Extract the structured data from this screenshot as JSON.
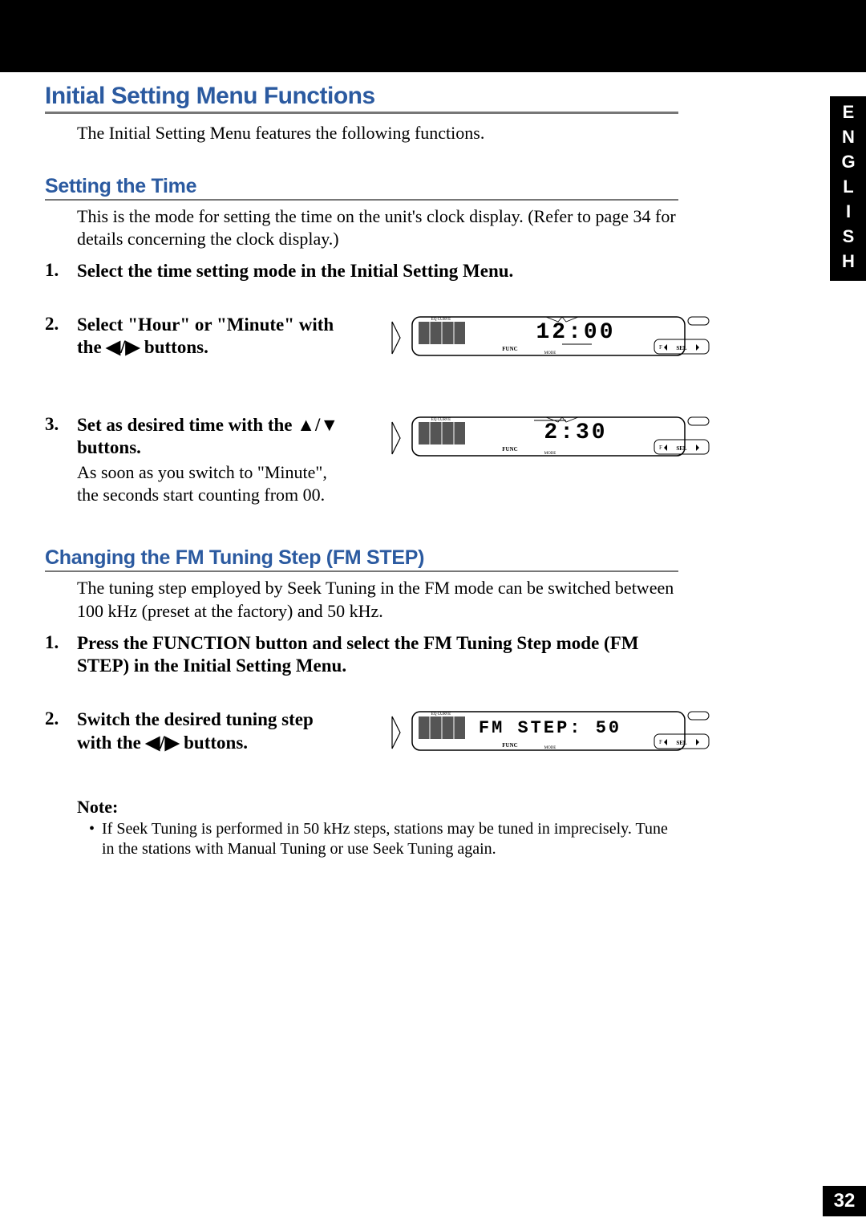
{
  "language_tab": "ENGLISH",
  "page_number": "32",
  "heading_main": "Initial Setting Menu Functions",
  "intro_text": "The Initial Setting Menu features the following functions.",
  "section_time": {
    "heading": "Setting the Time",
    "body": "This is the mode for setting the time on the unit's clock display. (Refer to page 34 for details concerning the clock display.)",
    "steps": [
      {
        "num": "1.",
        "title": "Select the time setting mode in the Initial Setting Menu."
      },
      {
        "num": "2.",
        "title": "Select \"Hour\" or \"Minute\" with the ◀/▶ buttons."
      },
      {
        "num": "3.",
        "title": "Set as desired time with the ▲/▼ buttons.",
        "sub": "As soon as you switch to \"Minute\", the seconds start counting from 00."
      }
    ],
    "lcd1": {
      "eq_label": "EQ CURVE",
      "func_label": "FUNC",
      "mode_label": "MODE",
      "sel_label": "SEL",
      "f_label": "F",
      "display": "12:00"
    },
    "lcd2": {
      "eq_label": "EQ CURVE",
      "func_label": "FUNC",
      "mode_label": "MODE",
      "sel_label": "SEL",
      "f_label": "F",
      "display": " 2:30"
    }
  },
  "section_fm": {
    "heading": "Changing the FM Tuning Step (FM STEP)",
    "body": "The tuning step employed by Seek Tuning in the FM mode can be switched between 100 kHz (preset at the factory) and 50 kHz.",
    "steps": [
      {
        "num": "1.",
        "title": "Press the FUNCTION button and select the FM Tuning Step mode (FM STEP) in the Initial Setting Menu."
      },
      {
        "num": "2.",
        "title": "Switch the desired tuning step with the ◀/▶ buttons."
      }
    ],
    "lcd": {
      "eq_label": "EQ CURVE",
      "func_label": "FUNC",
      "mode_label": "MODE",
      "sel_label": "SEL",
      "f_label": "F",
      "display": "FM STEP: 50"
    },
    "note_heading": "Note:",
    "note_items": [
      "If Seek Tuning is performed in 50 kHz steps, stations may be tuned in imprecisely. Tune in the stations with Manual Tuning or use Seek Tuning again."
    ]
  }
}
